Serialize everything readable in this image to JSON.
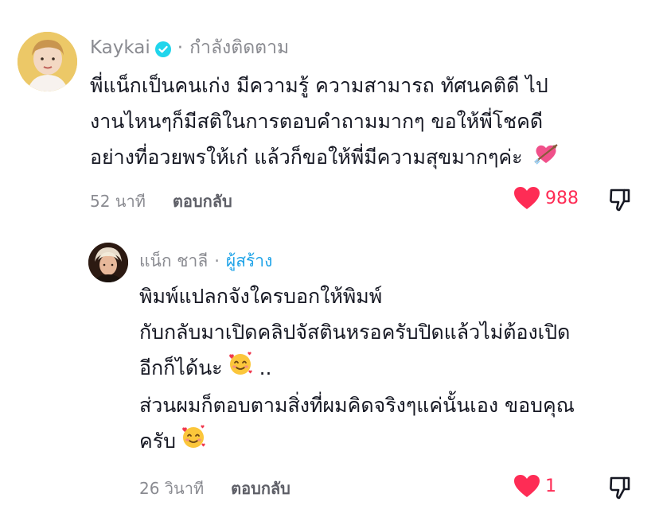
{
  "main_comment": {
    "author": "Kaykai",
    "status": "กำลังติดตาม",
    "lines": [
      "พี่แน็กเป็นคนเก่ง มีความรู้ ความสามารถ ทัศนคติดี ไป",
      "งานไหนๆก็มีสติในการตอบคำถามมากๆ ขอให้พี่โชคดี",
      "อย่างที่อวยพรให้เก๋ แล้วก็ขอให้พี่มีความสุขมากๆค่ะ"
    ],
    "time": "52 นาที",
    "reply_label": "ตอบกลับ",
    "likes": "988"
  },
  "reply_comment": {
    "author": "แน็ก ชาลี",
    "role": "ผู้สร้าง",
    "lines": [
      "พิมพ์แปลกจังใครบอกให้พิมพ์",
      "กับกลับมาเปิดคลิปจัสตินหรอครับปิดแล้วไม่ต้องเปิด",
      "อีกก็ได้นะ",
      "ส่วนผมก็ตอบตามสิ่งที่ผมคิดจริงๆแค่นั้นเอง ขอบคุณ",
      "ครับ"
    ],
    "line3_suffix": " ..",
    "time": "26 วินาที",
    "reply_label": "ตอบกลับ",
    "likes": "1"
  },
  "colors": {
    "like_red": "#fe2c55",
    "creator_blue": "#20a4e8",
    "muted_gray": "#8a8b91"
  },
  "icons": {
    "verified": "verified-check-icon",
    "heart_arrow": "heart-with-arrow-emoji",
    "blush": "smiling-face-with-hearts-emoji",
    "like": "heart-icon",
    "dislike": "thumbs-down-icon"
  }
}
